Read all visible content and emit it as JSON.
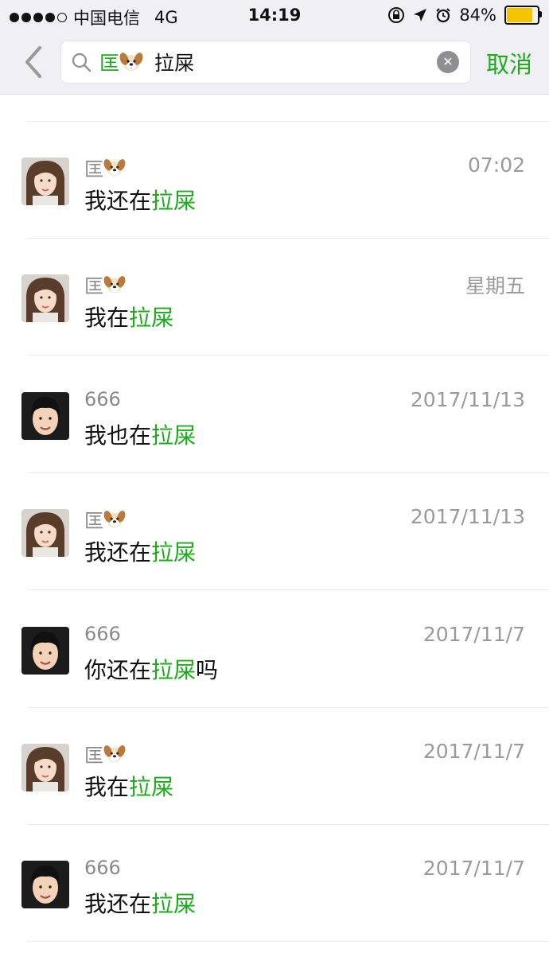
{
  "status_bar": {
    "carrier": "中国电信",
    "network": "4G",
    "time": "14:19",
    "battery": "84%",
    "battery_level": 0.84,
    "battery_color": "#f5c400"
  },
  "search": {
    "contact_tag": "匡",
    "contact_emoji_icon": "dog-face-icon",
    "query": "拉屎",
    "cancel_label": "取消",
    "accent_color": "#1aad19"
  },
  "results": [
    {
      "name": "匡",
      "has_dog_emoji": true,
      "avatar": "woman-avatar",
      "date": "07:02",
      "msg_before": "我还在",
      "msg_highlight": "拉屎",
      "msg_after": ""
    },
    {
      "name": "匡",
      "has_dog_emoji": true,
      "avatar": "woman-avatar",
      "date": "星期五",
      "msg_before": "我在",
      "msg_highlight": "拉屎",
      "msg_after": ""
    },
    {
      "name": "666",
      "has_dog_emoji": false,
      "avatar": "bangs-avatar",
      "date": "2017/11/13",
      "msg_before": "我也在",
      "msg_highlight": "拉屎",
      "msg_after": ""
    },
    {
      "name": "匡",
      "has_dog_emoji": true,
      "avatar": "woman-avatar",
      "date": "2017/11/13",
      "msg_before": "我还在",
      "msg_highlight": "拉屎",
      "msg_after": ""
    },
    {
      "name": "666",
      "has_dog_emoji": false,
      "avatar": "bangs-avatar",
      "date": "2017/11/7",
      "msg_before": "你还在",
      "msg_highlight": "拉屎",
      "msg_after": "吗"
    },
    {
      "name": "匡",
      "has_dog_emoji": true,
      "avatar": "woman-avatar",
      "date": "2017/11/7",
      "msg_before": "我在",
      "msg_highlight": "拉屎",
      "msg_after": ""
    },
    {
      "name": "666",
      "has_dog_emoji": false,
      "avatar": "bangs-avatar",
      "date": "2017/11/7",
      "msg_before": "我还在",
      "msg_highlight": "拉屎",
      "msg_after": ""
    }
  ]
}
